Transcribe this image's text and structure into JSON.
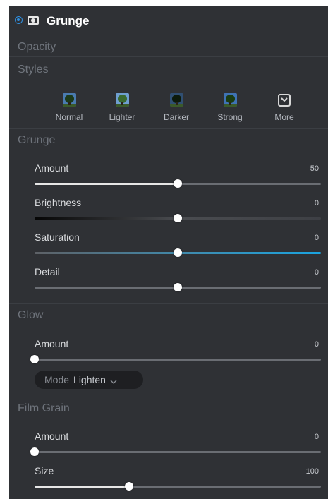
{
  "layer": {
    "title": "Grunge",
    "radio_icon": "radio-selected-icon",
    "mask_icon": "mask-icon"
  },
  "sections": {
    "opacity": "Opacity",
    "styles": "Styles",
    "grunge": "Grunge",
    "glow": "Glow",
    "film_grain": "Film Grain"
  },
  "styles": [
    {
      "label": "Normal",
      "icon": "tree-thumbnail-icon"
    },
    {
      "label": "Lighter",
      "icon": "tree-thumbnail-icon"
    },
    {
      "label": "Darker",
      "icon": "tree-thumbnail-icon"
    },
    {
      "label": "Strong",
      "icon": "tree-thumbnail-icon"
    },
    {
      "label": "More",
      "icon": "chevron-down-box-icon"
    }
  ],
  "grunge": {
    "amount": {
      "label": "Amount",
      "value": "50",
      "fraction": 0.5
    },
    "brightness": {
      "label": "Brightness",
      "value": "0",
      "fraction": 0.5
    },
    "saturation": {
      "label": "Saturation",
      "value": "0",
      "fraction": 0.5
    },
    "detail": {
      "label": "Detail",
      "value": "0",
      "fraction": 0.5
    }
  },
  "glow": {
    "amount": {
      "label": "Amount",
      "value": "0",
      "fraction": 0.0
    },
    "mode_label": "Mode",
    "mode_value": "Lighten"
  },
  "film_grain": {
    "amount": {
      "label": "Amount",
      "value": "0",
      "fraction": 0.0
    },
    "size": {
      "label": "Size",
      "value": "100",
      "fraction": 0.33
    }
  },
  "colors": {
    "panel_bg": "#2f3135",
    "accent": "#2f8fe0",
    "saturation_end": "#1aa4e0"
  }
}
